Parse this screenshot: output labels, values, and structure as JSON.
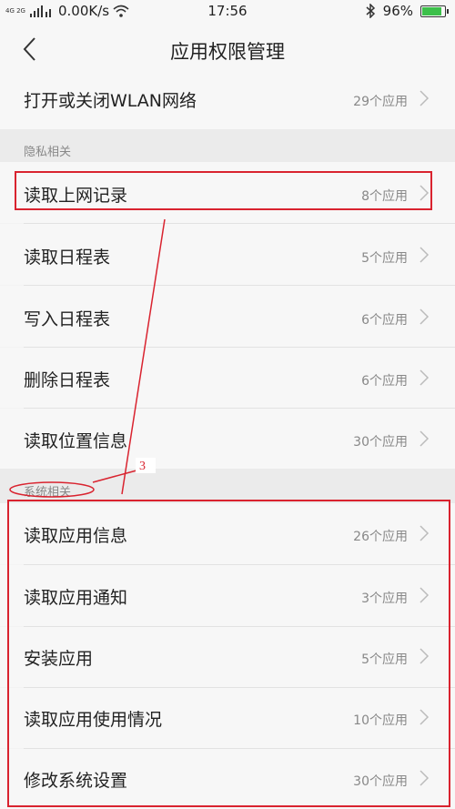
{
  "status_bar": {
    "network_tags": "4G 2G",
    "speed": "0.00K/s",
    "time": "17:56",
    "battery": "96%",
    "battery_level": 0.96,
    "icons": [
      "signal-icon",
      "wifi-icon",
      "bluetooth-icon",
      "battery-icon"
    ]
  },
  "nav": {
    "title": "应用权限管理",
    "back_icon": "chevron-left-icon"
  },
  "top_item": {
    "label": "打开或关闭WLAN网络",
    "count": "29个应用"
  },
  "sections": [
    {
      "header": "隐私相关",
      "items": [
        {
          "label": "读取上网记录",
          "count": "8个应用"
        },
        {
          "label": "读取日程表",
          "count": "5个应用"
        },
        {
          "label": "写入日程表",
          "count": "6个应用"
        },
        {
          "label": "删除日程表",
          "count": "6个应用"
        },
        {
          "label": "读取位置信息",
          "count": "30个应用"
        }
      ]
    },
    {
      "header": "系统相关",
      "items": [
        {
          "label": "读取应用信息",
          "count": "26个应用"
        },
        {
          "label": "读取应用通知",
          "count": "3个应用"
        },
        {
          "label": "安装应用",
          "count": "5个应用"
        },
        {
          "label": "读取应用使用情况",
          "count": "10个应用"
        },
        {
          "label": "修改系统设置",
          "count": "30个应用"
        }
      ]
    }
  ],
  "annotation": {
    "step_number": "3",
    "color": "#d9232f"
  }
}
